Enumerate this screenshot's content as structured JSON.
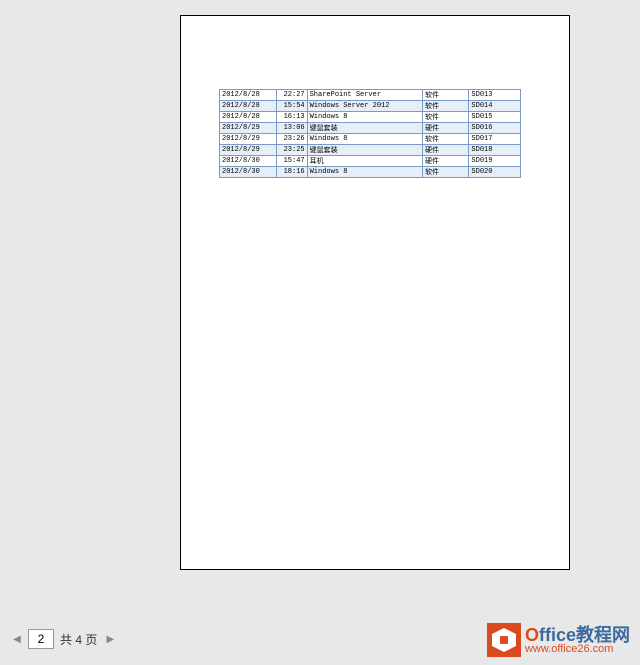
{
  "table": {
    "rows": [
      {
        "date": "2012/8/28",
        "time": "22:27",
        "name": "SharePoint Server",
        "type": "软件",
        "code": "SD013"
      },
      {
        "date": "2012/8/28",
        "time": "15:54",
        "name": "Windows Server 2012",
        "type": "软件",
        "code": "SD014"
      },
      {
        "date": "2012/8/28",
        "time": "16:13",
        "name": "Windows 8",
        "type": "软件",
        "code": "SD015"
      },
      {
        "date": "2012/8/29",
        "time": "13:06",
        "name": "键鼠套装",
        "type": "硬件",
        "code": "SD016"
      },
      {
        "date": "2012/8/29",
        "time": "23:26",
        "name": "Windows 8",
        "type": "软件",
        "code": "SD017"
      },
      {
        "date": "2012/8/29",
        "time": "23:25",
        "name": "键鼠套装",
        "type": "硬件",
        "code": "SD018"
      },
      {
        "date": "2012/8/30",
        "time": "15:47",
        "name": "耳机",
        "type": "硬件",
        "code": "SD019"
      },
      {
        "date": "2012/8/30",
        "time": "18:16",
        "name": "Windows 8",
        "type": "软件",
        "code": "SD020"
      }
    ]
  },
  "pager": {
    "prev_icon": "◀",
    "next_icon": "▶",
    "current": "2",
    "total_label": "共 4 页"
  },
  "watermark": {
    "brand_o": "O",
    "brand_rest": "ffice教程网",
    "url": "www.office26.com"
  }
}
